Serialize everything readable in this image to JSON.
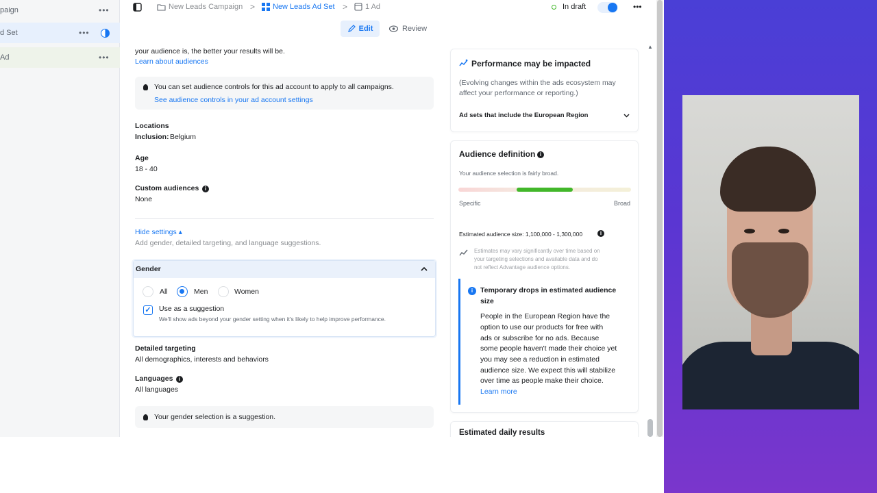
{
  "sidebar": {
    "items": [
      {
        "label": "paign"
      },
      {
        "label": "d Set"
      },
      {
        "label": "Ad"
      }
    ],
    "more": "•••"
  },
  "breadcrumb": {
    "campaign": "New Leads Campaign",
    "adset": "New Leads Ad Set",
    "ad": "1 Ad",
    "separator": ">"
  },
  "status": {
    "label": "In draft",
    "more": "•••"
  },
  "tabs": {
    "edit": "Edit",
    "review": "Review"
  },
  "audience": {
    "intro": "your audience is, the better your results will be.",
    "learn_link": "Learn about audiences",
    "controls_note": "You can set audience controls for this ad account to apply to all campaigns.",
    "controls_link": "See audience controls in your ad account settings",
    "locations_title": "Locations",
    "inclusion_label": "Inclusion:",
    "inclusion_value": "Belgium",
    "age_title": "Age",
    "age_value": "18 - 40",
    "custom_title": "Custom audiences",
    "custom_value": "None",
    "hide_settings": "Hide settings ▴",
    "hide_settings_desc": "Add gender, detailed targeting, and language suggestions.",
    "gender": {
      "title": "Gender",
      "options": [
        "All",
        "Men",
        "Women"
      ],
      "selected": "Men",
      "suggestion_label": "Use as a suggestion",
      "suggestion_desc": "We'll show ads beyond your gender setting when it's likely to help improve performance."
    },
    "detailed_title": "Detailed targeting",
    "detailed_value": "All demographics, interests and behaviors",
    "languages_title": "Languages",
    "languages_value": "All languages",
    "gender_note": "Your gender selection is a suggestion."
  },
  "performance": {
    "title": "Performance may be impacted",
    "body_line1": "(Evolving changes within the ads ecosystem may",
    "body_line2": "affect your performance or reporting.)",
    "dropdown": "Ad sets that include the European Region"
  },
  "definition": {
    "title": "Audience definition",
    "subtitle": "Your audience selection is fairly broad.",
    "left_label": "Specific",
    "right_label": "Broad",
    "estimated": "Estimated audience size: 1,100,000 - 1,300,000",
    "disclaimer_1": "Estimates may vary significantly over time based on",
    "disclaimer_2": "your targeting selections and available data and do",
    "disclaimer_3": "not reflect Advantage audience options."
  },
  "temporary": {
    "title_1": "Temporary drops in estimated audience",
    "title_2": "size",
    "lines": [
      "People in the European Region have the",
      "option to use our products for free with",
      "ads or subscribe for no ads. Because",
      "some people haven't made their choice yet",
      "you may see a reduction in estimated",
      "audience size. We expect this will stabilize",
      "over time as people make their choice."
    ],
    "learn_more": "Learn more"
  },
  "daily": {
    "title": "Estimated daily results"
  },
  "colors": {
    "accent": "#1877f2",
    "success": "#42b72a",
    "video_bg": "#5a36d2"
  }
}
